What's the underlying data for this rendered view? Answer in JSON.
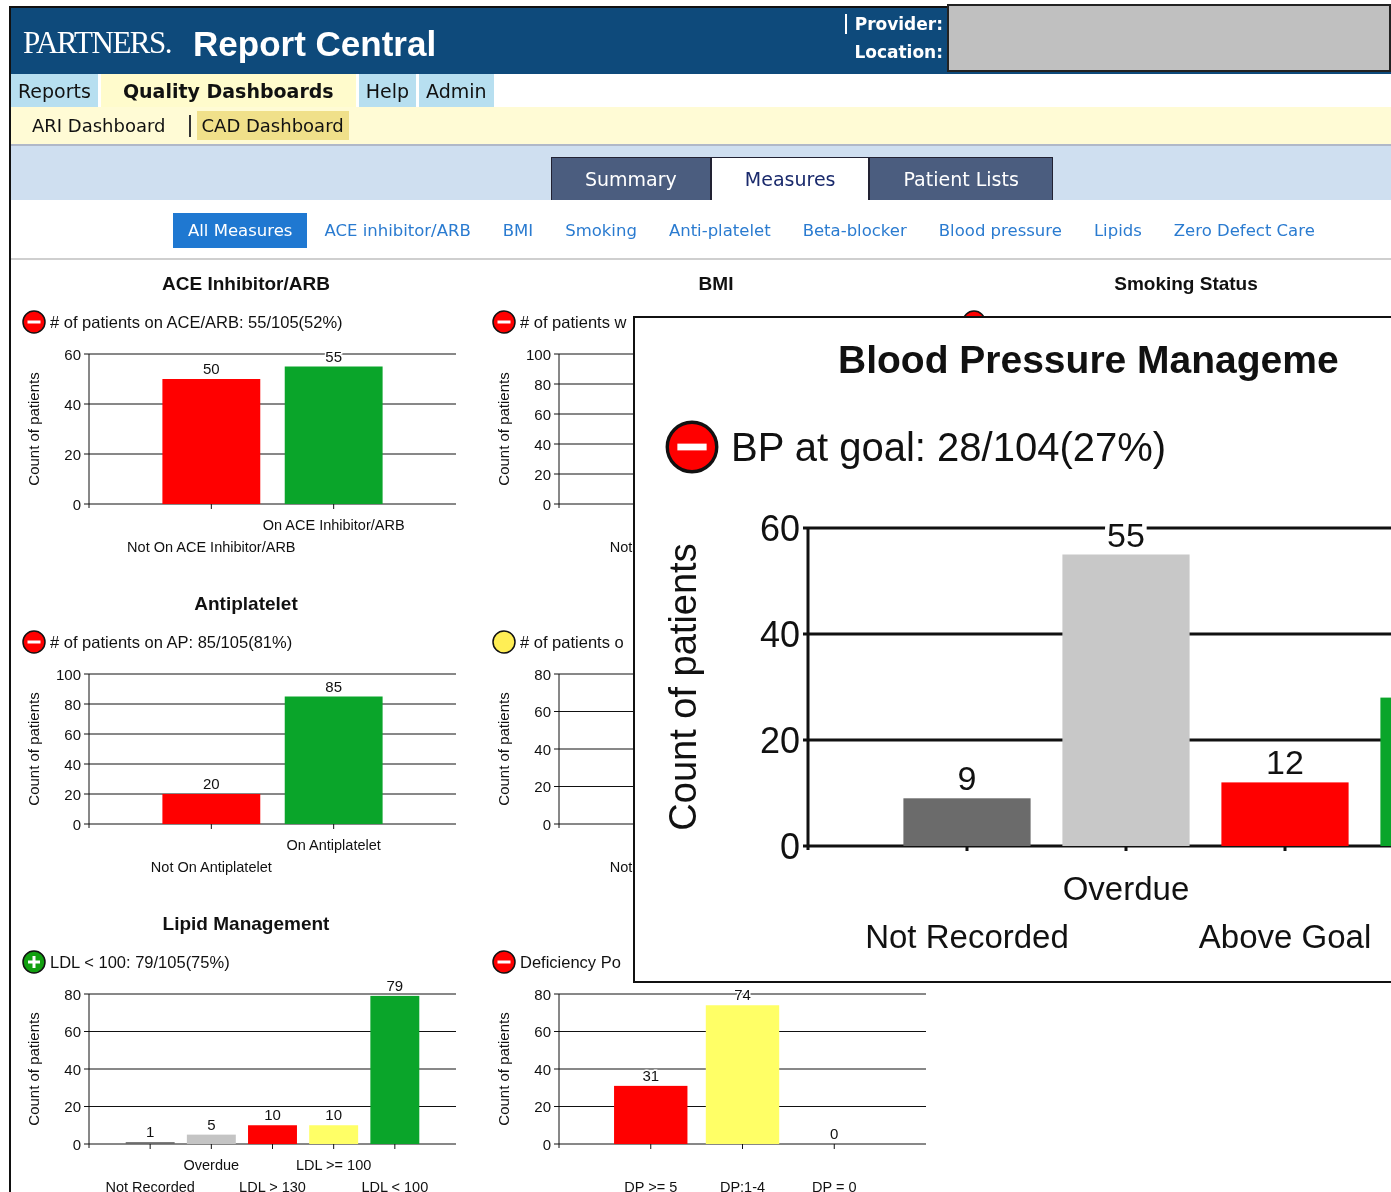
{
  "header": {
    "logo": "PARTNERS.",
    "title": "Report Central",
    "provider_label": "Provider:",
    "location_label": "Location:"
  },
  "menu": [
    {
      "label": "Reports",
      "selected": false
    },
    {
      "label": "Quality Dashboards",
      "selected": true
    },
    {
      "label": "Help",
      "selected": false
    },
    {
      "label": "Admin",
      "selected": false
    }
  ],
  "submenu": [
    {
      "label": "ARI Dashboard",
      "selected": false
    },
    {
      "label": "CAD Dashboard",
      "selected": true
    }
  ],
  "view_tabs": [
    {
      "label": "Summary",
      "selected": false
    },
    {
      "label": "Measures",
      "selected": true
    },
    {
      "label": "Patient Lists",
      "selected": false
    }
  ],
  "measure_filters": [
    {
      "label": "All Measures",
      "selected": true
    },
    {
      "label": "ACE inhibitor/ARB",
      "selected": false
    },
    {
      "label": "BMI",
      "selected": false
    },
    {
      "label": "Smoking",
      "selected": false
    },
    {
      "label": "Anti-platelet",
      "selected": false
    },
    {
      "label": "Beta-blocker",
      "selected": false
    },
    {
      "label": "Blood pressure",
      "selected": false
    },
    {
      "label": "Lipids",
      "selected": false
    },
    {
      "label": "Zero Defect Care",
      "selected": false
    }
  ],
  "rows": [
    {
      "panels": [
        {
          "title": "ACE Inhibitor/ARB",
          "status_icon": {
            "kind": "minus",
            "color": "#ff0000"
          },
          "summary": "# of patients on ACE/ARB: 55/105(52%)",
          "chart_data": {
            "type": "bar",
            "ylabel": "Count of patients",
            "categories": [
              "Not On ACE Inhibitor/ARB",
              "On ACE Inhibitor/ARB"
            ],
            "grid": true,
            "ylim": [
              0,
              60
            ],
            "yticks": [
              0,
              20,
              40,
              60
            ],
            "value_labels": [
              "50",
              "55"
            ],
            "series": [
              {
                "color": "#ff0000",
                "values": [
                  50,
                  null
                ]
              },
              {
                "color": "#0aa52a",
                "values": [
                  null,
                  55
                ]
              }
            ]
          }
        },
        {
          "title": "BMI",
          "status_icon": {
            "kind": "minus",
            "color": "#ff0000"
          },
          "summary": "# of patients w",
          "chart_data": {
            "type": "bar",
            "ylabel": "Count of patients",
            "categories": [
              "Not"
            ],
            "grid": true,
            "ylim": [
              0,
              100
            ],
            "yticks": [
              0,
              20,
              40,
              60,
              80,
              100
            ]
          }
        },
        {
          "title": "Smoking Status",
          "status_icon": {
            "kind": "minus",
            "color": "#ff0000"
          }
        }
      ]
    },
    {
      "panels": [
        {
          "title": "Antiplatelet",
          "status_icon": {
            "kind": "minus",
            "color": "#ff0000"
          },
          "summary": "# of patients on AP: 85/105(81%)",
          "chart_data": {
            "type": "bar",
            "ylabel": "Count of patients",
            "categories": [
              "Not On Antiplatelet",
              "On Antiplatelet"
            ],
            "grid": true,
            "ylim": [
              0,
              100
            ],
            "yticks": [
              0,
              20,
              40,
              60,
              80,
              100
            ],
            "value_labels": [
              "20",
              "85"
            ],
            "series": [
              {
                "color": "#ff0000",
                "values": [
                  20,
                  null
                ]
              },
              {
                "color": "#0aa52a",
                "values": [
                  null,
                  85
                ]
              }
            ]
          }
        },
        {
          "status_icon": {
            "kind": "dot",
            "color": "#ffee55"
          },
          "summary": "# of patients o",
          "chart_data": {
            "type": "bar",
            "ylabel": "Count of patients",
            "categories": [
              "Not"
            ],
            "grid": true,
            "ylim": [
              0,
              80
            ],
            "yticks": [
              0,
              20,
              40,
              60,
              80
            ]
          }
        }
      ]
    },
    {
      "panels": [
        {
          "title": "Lipid Management",
          "status_icon": {
            "kind": "plus",
            "color": "#12a010"
          },
          "summary": "LDL < 100: 79/105(75%)",
          "chart_data": {
            "type": "bar",
            "ylabel": "Count of patients",
            "categories": [
              "Not Recorded",
              "Overdue",
              "LDL > 130",
              "LDL >= 100",
              "LDL < 100"
            ],
            "grid": true,
            "ylim": [
              0,
              80
            ],
            "yticks": [
              0,
              20,
              40,
              60,
              80
            ],
            "value_labels": [
              "1",
              "5",
              "10",
              "10",
              "79"
            ],
            "series": [
              {
                "color": "#6b6b6b",
                "values": [
                  1,
                  null,
                  null,
                  null,
                  null
                ]
              },
              {
                "color": "#c4c4c4",
                "values": [
                  null,
                  5,
                  null,
                  null,
                  null
                ]
              },
              {
                "color": "#ff0000",
                "values": [
                  null,
                  null,
                  10,
                  null,
                  null
                ]
              },
              {
                "color": "#ffff66",
                "values": [
                  null,
                  null,
                  null,
                  10,
                  null
                ]
              },
              {
                "color": "#0aa52a",
                "values": [
                  null,
                  null,
                  null,
                  null,
                  79
                ]
              }
            ]
          }
        },
        {
          "status_icon": {
            "kind": "minus",
            "color": "#ff0000"
          },
          "summary": "Deficiency Po",
          "chart_data": {
            "type": "bar",
            "ylabel": "Count of patients",
            "categories": [
              "DP >= 5",
              "DP:1-4",
              "DP = 0"
            ],
            "grid": true,
            "ylim": [
              0,
              80
            ],
            "yticks": [
              0,
              20,
              40,
              60,
              80
            ],
            "value_labels": [
              "31",
              "74",
              "0"
            ],
            "series": [
              {
                "color": "#ff0000",
                "values": [
                  31,
                  null,
                  null
                ]
              },
              {
                "color": "#ffff66",
                "values": [
                  null,
                  74,
                  null
                ]
              },
              {
                "values": [
                  null,
                  null,
                  0
                ]
              }
            ]
          }
        }
      ]
    }
  ],
  "popup": {
    "title": "Blood Pressure Manageme",
    "status_icon": {
      "kind": "minus",
      "color": "#ff0000"
    },
    "summary": "BP at goal: 28/104(27%)",
    "chart_data": {
      "type": "bar",
      "ylabel": "Count of patients",
      "categories": [
        "Not Recorded",
        "Overdue",
        "Above Goal",
        null
      ],
      "grid": true,
      "ylim": [
        0,
        60
      ],
      "yticks": [
        0,
        20,
        40,
        60
      ],
      "value_labels": [
        "9",
        "55",
        "12",
        null
      ],
      "series": [
        {
          "color": "#6b6b6b",
          "values": [
            9,
            null,
            null,
            null
          ]
        },
        {
          "color": "#c8c8c8",
          "values": [
            null,
            55,
            null,
            null
          ]
        },
        {
          "color": "#ff0000",
          "values": [
            null,
            null,
            12,
            null
          ]
        },
        {
          "color": "#0aa52a",
          "values": [
            null,
            null,
            null,
            28
          ]
        }
      ]
    }
  }
}
